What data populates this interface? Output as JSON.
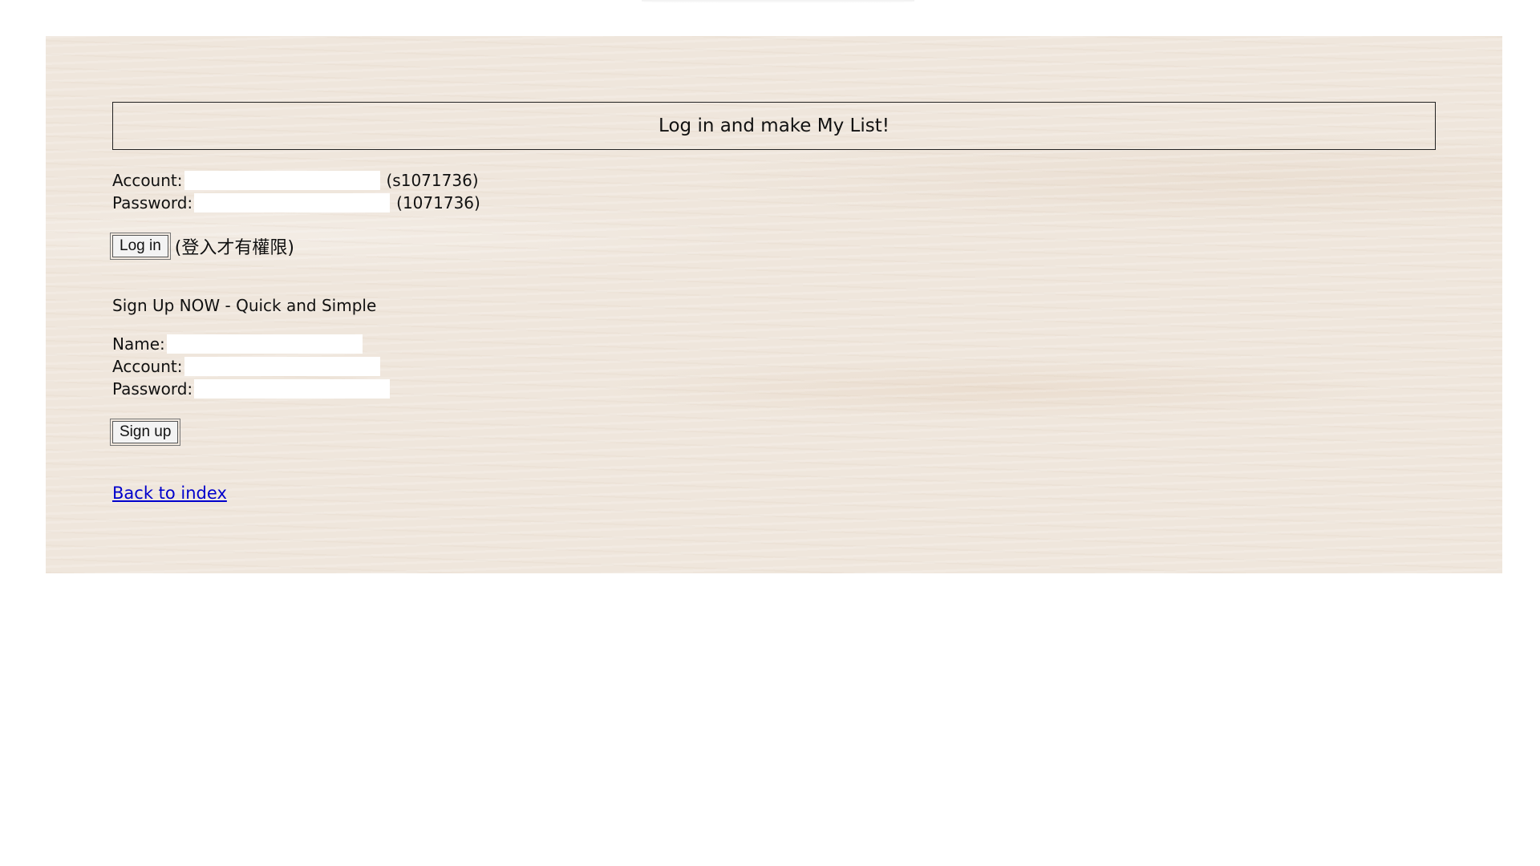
{
  "login": {
    "title": "Log in and make My List!",
    "account_label": "Account:",
    "account_value": "",
    "account_hint": "(s1071736)",
    "password_label": "Password:",
    "password_value": "",
    "password_hint": "(1071736)",
    "button_label": "Log in",
    "button_note": "(登入才有權限)"
  },
  "signup": {
    "heading": "Sign Up NOW - Quick and Simple",
    "name_label": "Name:",
    "account_label": "Account:",
    "password_label": "Password:",
    "button_label": "Sign up"
  },
  "footer": {
    "back_link": "Back to index"
  },
  "colors": {
    "panel_background": "#efe6dc",
    "link": "#0000cc"
  }
}
